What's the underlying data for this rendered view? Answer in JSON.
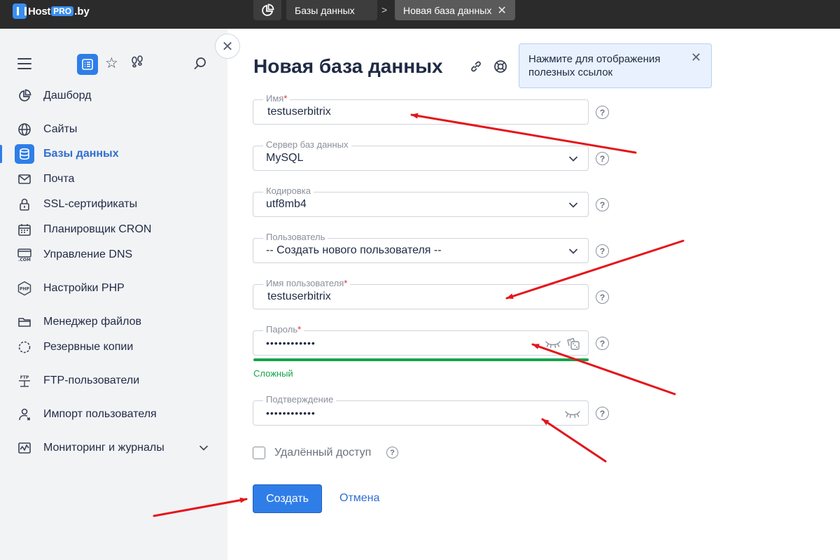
{
  "app": {
    "logo_host": "Host",
    "logo_pro": "PRO",
    "logo_by": ".by"
  },
  "topbar": {
    "home_icon": "dashboard-pie-icon",
    "breadcrumb": "Базы данных",
    "separator": ">",
    "active_tab": "Новая база данных",
    "close_symbol": "✕"
  },
  "sidebar": {
    "toolbar": {
      "menu_icon": "hamburger-icon",
      "list_icon": "list-icon",
      "favorites_icon": "star-icon",
      "footprints_icon": "footprints-icon",
      "search_icon": "search-icon"
    },
    "items": [
      {
        "label": "Дашборд",
        "icon": "pie-chart-icon"
      },
      {
        "label": "Сайты",
        "icon": "globe-icon"
      },
      {
        "label": "Базы данных",
        "icon": "database-icon",
        "active": true
      },
      {
        "label": "Почта",
        "icon": "mail-icon"
      },
      {
        "label": "SSL-сертификаты",
        "icon": "lock-icon"
      },
      {
        "label": "Планировщик CRON",
        "icon": "calendar-icon"
      },
      {
        "label": "Управление DNS",
        "icon": "dns-icon",
        "icon_text": ".COM"
      },
      {
        "label": "Настройки PHP",
        "icon": "php-icon",
        "icon_text": "PHP"
      },
      {
        "label": "Менеджер файлов",
        "icon": "folder-icon"
      },
      {
        "label": "Резервные копии",
        "icon": "backup-icon"
      },
      {
        "label": "FTP-пользователи",
        "icon": "ftp-icon",
        "icon_text": "FTP"
      },
      {
        "label": "Импорт пользователя",
        "icon": "user-import-icon"
      },
      {
        "label": "Мониторинг и журналы",
        "icon": "monitoring-icon",
        "expandable": true
      }
    ],
    "collapse_symbol": "✕"
  },
  "main": {
    "title": "Новая база данных",
    "tooltip": {
      "text": "Нажмите для отображения полезных ссылок",
      "close_symbol": "✕"
    },
    "form": {
      "name": {
        "label": "Имя",
        "required_mark": "*",
        "value": "testuserbitrix"
      },
      "db_server": {
        "label": "Сервер баз данных",
        "value": "MySQL"
      },
      "encoding": {
        "label": "Кодировка",
        "value": "utf8mb4"
      },
      "user": {
        "label": "Пользователь",
        "value": "-- Создать нового пользователя --"
      },
      "username": {
        "label": "Имя пользователя",
        "required_mark": "*",
        "value": "testuserbitrix"
      },
      "password": {
        "label": "Пароль",
        "required_mark": "*",
        "value": "••••••••••••",
        "strength": "Сложный",
        "strength_level": 1.0
      },
      "confirm": {
        "label": "Подтверждение",
        "value": "••••••••••••"
      },
      "remote_access": {
        "label": "Удалённый доступ",
        "checked": false
      },
      "help_symbol": "?"
    },
    "buttons": {
      "create": "Создать",
      "cancel": "Отмена"
    }
  },
  "colors": {
    "accent": "#2f7ee8",
    "topbar": "#2b2b2b",
    "sidebar_bg": "#f2f3f5",
    "success": "#16a34a",
    "annotation_arrow": "#e5141b"
  }
}
